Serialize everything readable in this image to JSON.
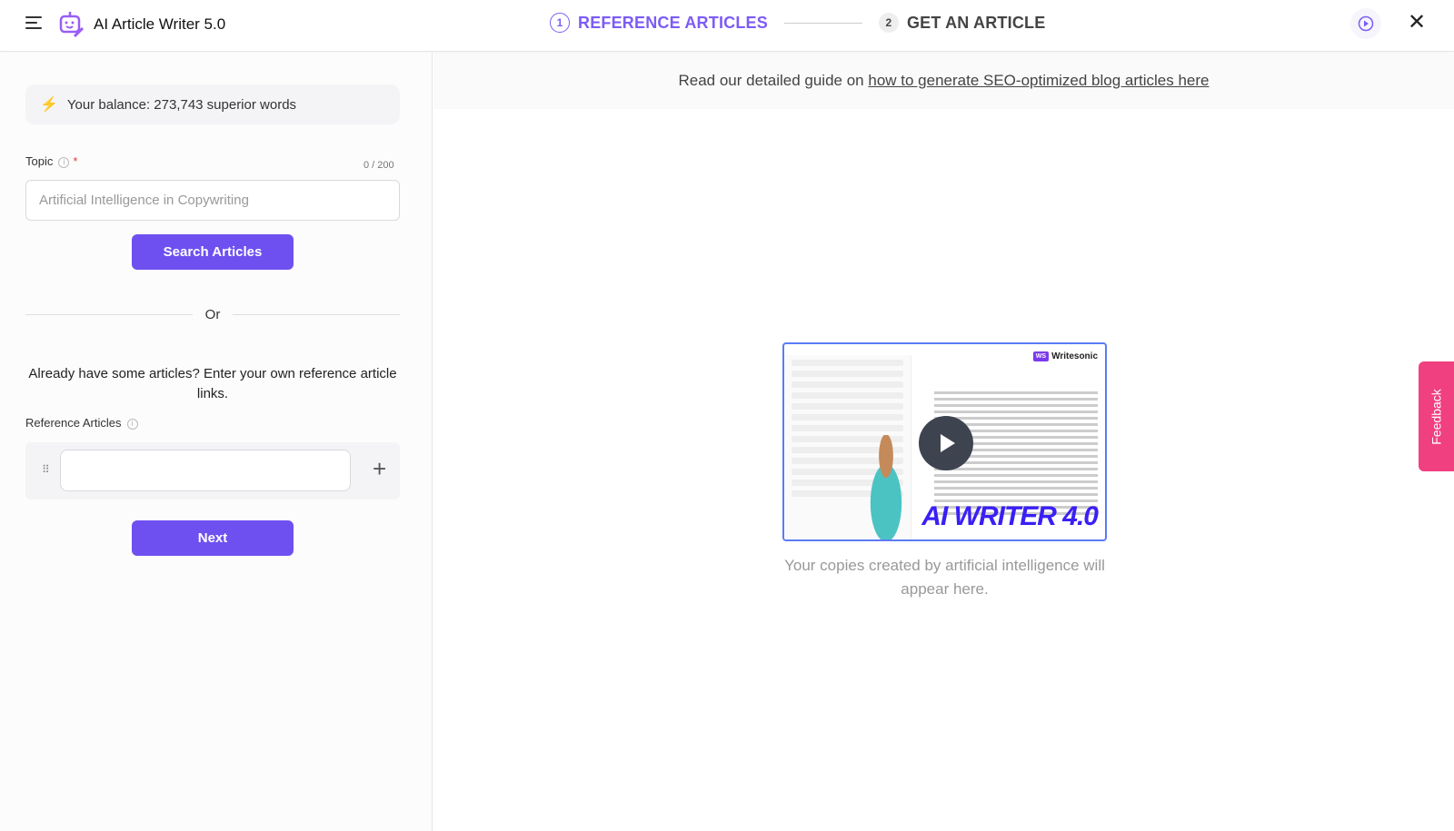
{
  "header": {
    "app_title": "AI Article Writer 5.0",
    "steps": [
      {
        "num": "1",
        "label": "REFERENCE ARTICLES",
        "active": true
      },
      {
        "num": "2",
        "label": "GET AN ARTICLE",
        "active": false
      }
    ],
    "accent": "#7c5cf5"
  },
  "sidebar": {
    "balance": "Your balance: 273,743 superior words",
    "topic": {
      "label": "Topic",
      "required": "*",
      "counter": "0 / 200",
      "placeholder": "Artificial Intelligence in Copywriting",
      "value": ""
    },
    "search_button": "Search Articles",
    "or_label": "Or",
    "own_articles_text": "Already have some articles? Enter your own reference article links.",
    "reference_label": "Reference Articles",
    "reference_inputs": [
      ""
    ],
    "next_button": "Next"
  },
  "main": {
    "guide_prefix": "Read our detailed guide on ",
    "guide_link": "how to generate SEO-optimized blog articles here",
    "video": {
      "brand": "Writesonic",
      "brand_badge": "WS",
      "title": "AI WRITER 4.0"
    },
    "empty_text": "Your copies created by artificial intelligence will appear here."
  },
  "feedback_label": "Feedback"
}
